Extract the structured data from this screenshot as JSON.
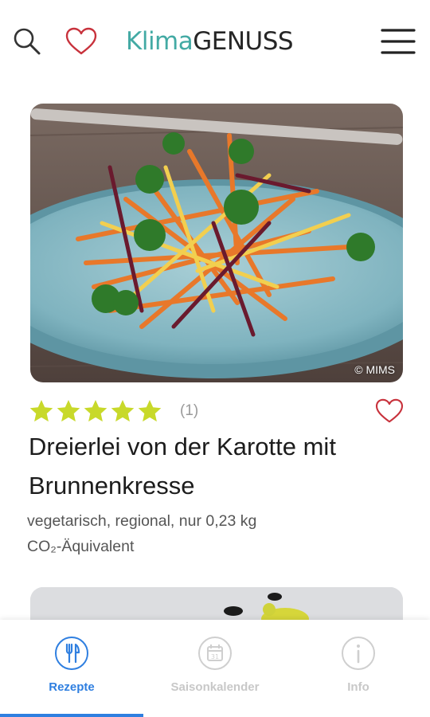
{
  "header": {
    "logo_part1": "Klima",
    "logo_part2": "GENUSS"
  },
  "recipe": {
    "image_alt": "Salat aus Karotten und Roten Beten mit Brunnenkresse",
    "copyright": "© MIMS",
    "rating": 5,
    "rating_count": "(1)",
    "title": "Dreierlei von der Karotte mit Brunnenkresse",
    "meta_line1": "vegetarisch, regional, nur 0,23 kg",
    "meta_line2": "CO₂-Äquivalent"
  },
  "bottom_nav": [
    {
      "label": "Rezepte",
      "icon": "cutlery-icon",
      "active": true
    },
    {
      "label": "Saisonkalender",
      "icon": "calendar-icon",
      "active": false
    },
    {
      "label": "Info",
      "icon": "info-icon",
      "active": false
    }
  ],
  "colors": {
    "accent": "#2f7fe0",
    "logo_teal": "#43aaa4",
    "star": "#c8d92a",
    "heart": "#c8323c"
  }
}
